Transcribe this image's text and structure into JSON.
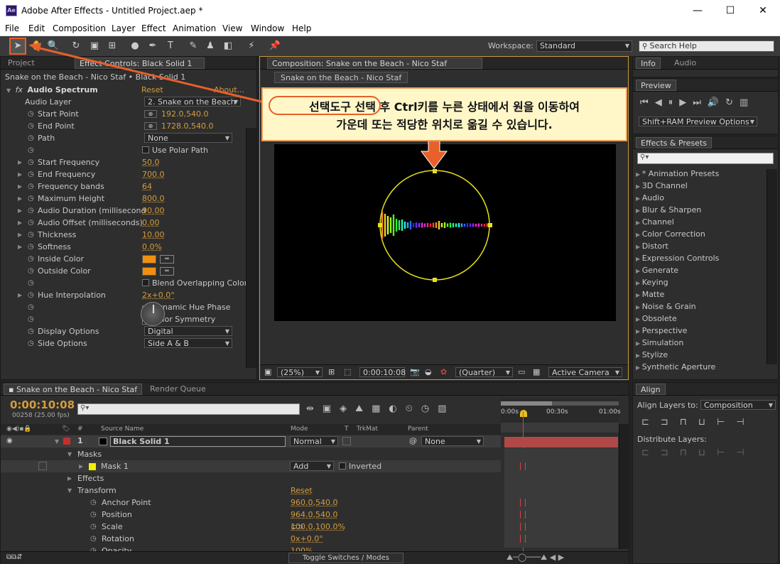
{
  "window": {
    "title": "Adobe After Effects - Untitled Project.aep *",
    "icon": "Ae",
    "min": "—",
    "max": "☐",
    "close": "✕"
  },
  "menu": [
    "File",
    "Edit",
    "Composition",
    "Layer",
    "Effect",
    "Animation",
    "View",
    "Window",
    "Help"
  ],
  "toolbar": {
    "workspace_label": "Workspace:",
    "workspace_value": "Standard",
    "search_placeholder": "Search Help"
  },
  "effects_panel": {
    "tab_project": "Project",
    "tab_effect": "Effect Controls: Black Solid 1",
    "breadcrumb": "Snake on the Beach - Nico Staf • Black Solid 1",
    "effect_name": "Audio Spectrum",
    "reset": "Reset",
    "about": "About...",
    "props": [
      {
        "label": "Audio Layer",
        "value": "2. Snake on the Beach",
        "type": "dd"
      },
      {
        "label": "Start Point",
        "value": "192.0,540.0",
        "type": "point"
      },
      {
        "label": "End Point",
        "value": "1728.0,540.0",
        "type": "point"
      },
      {
        "label": "Path",
        "value": "None",
        "type": "dd"
      },
      {
        "label": "",
        "value": "Use Polar Path",
        "type": "check"
      },
      {
        "label": "Start Frequency",
        "value": "50.0",
        "type": "num"
      },
      {
        "label": "End Frequency",
        "value": "700.0",
        "type": "num"
      },
      {
        "label": "Frequency bands",
        "value": "64",
        "type": "num"
      },
      {
        "label": "Maximum Height",
        "value": "800.0",
        "type": "num"
      },
      {
        "label": "Audio Duration (millisecond",
        "value": "90.00",
        "type": "num"
      },
      {
        "label": "Audio Offset (milliseconds)",
        "value": "0.00",
        "type": "num"
      },
      {
        "label": "Thickness",
        "value": "10.00",
        "type": "num"
      },
      {
        "label": "Softness",
        "value": "0.0%",
        "type": "num"
      },
      {
        "label": "Inside Color",
        "value": "",
        "type": "color"
      },
      {
        "label": "Outside Color",
        "value": "",
        "type": "color"
      },
      {
        "label": "",
        "value": "Blend Overlapping Color",
        "type": "check"
      },
      {
        "label": "Hue Interpolation",
        "value": "2x+0.0°",
        "type": "num"
      },
      {
        "label": "",
        "value": "Dynamic Hue Phase",
        "type": "checked"
      },
      {
        "label": "",
        "value": "Color Symmetry",
        "type": "checked"
      },
      {
        "label": "Display Options",
        "value": "Digital",
        "type": "dd"
      },
      {
        "label": "Side Options",
        "value": "Side A & B",
        "type": "dd"
      }
    ]
  },
  "comp": {
    "tab": "Composition: Snake on the Beach - Nico Staf",
    "subtab": "Snake on the Beach - Nico Staf",
    "zoom": "(25%)",
    "time": "0:00:10:08",
    "quality": "(Quarter)",
    "camera": "Active Camera"
  },
  "callout": {
    "line1": "선택도구 선택 후 Ctrl키를 누른 상태에서 원을 이동하여",
    "line2": "가운데 또는 적당한 위치로 옮길 수 있습니다."
  },
  "right": {
    "tab_info": "Info",
    "tab_audio": "Audio",
    "preview": "Preview",
    "preview_options": "Shift+RAM Preview Options",
    "effects_presets": "Effects & Presets",
    "categories": [
      "* Animation Presets",
      "3D Channel",
      "Audio",
      "Blur & Sharpen",
      "Channel",
      "Color Correction",
      "Distort",
      "Expression Controls",
      "Generate",
      "Keying",
      "Matte",
      "Noise & Grain",
      "Obsolete",
      "Perspective",
      "Simulation",
      "Stylize",
      "Synthetic Aperture"
    ],
    "align": "Align",
    "align_to": "Align Layers to:",
    "align_value": "Composition",
    "distribute": "Distribute Layers:"
  },
  "timeline": {
    "tab": "Snake on the Beach - Nico Staf",
    "tab2": "Render Queue",
    "timecode": "0:00:10:08",
    "frames": "00258 (25.00 fps)",
    "headers": {
      "hash": "#",
      "source": "Source Name",
      "mode": "Mode",
      "t": "T",
      "trkmat": "TrkMat",
      "parent": "Parent"
    },
    "ruler": [
      "0:00s",
      "00:30s",
      "01:00s"
    ],
    "layer": {
      "num": "1",
      "name": "Black Solid 1",
      "mode": "Normal",
      "parent": "None"
    },
    "rows": [
      {
        "label": "Masks",
        "indent": 1,
        "tri": true,
        "value": ""
      },
      {
        "label": "Mask 1",
        "indent": 2,
        "tri": true,
        "value": ""
      },
      {
        "label": "Effects",
        "indent": 1,
        "tri": true,
        "value": ""
      },
      {
        "label": "Transform",
        "indent": 1,
        "tri": true,
        "value": "Reset"
      },
      {
        "label": "Anchor Point",
        "indent": 2,
        "tri": false,
        "value": "960.0,540.0"
      },
      {
        "label": "Position",
        "indent": 2,
        "tri": false,
        "value": "964.0,540.0"
      },
      {
        "label": "Scale",
        "indent": 2,
        "tri": false,
        "value": "100.0,100.0%"
      },
      {
        "label": "Rotation",
        "indent": 2,
        "tri": false,
        "value": "0x+0.0°"
      },
      {
        "label": "Opacity",
        "indent": 2,
        "tri": false,
        "value": "100%"
      }
    ],
    "mask_mode": "Add",
    "inverted": "Inverted",
    "toggle": "Toggle Switches / Modes"
  },
  "colors": {
    "accent": "#d49c3c",
    "callout_bg": "#fff7c8",
    "arrow": "#e8602a",
    "ring": "#e8e020"
  }
}
